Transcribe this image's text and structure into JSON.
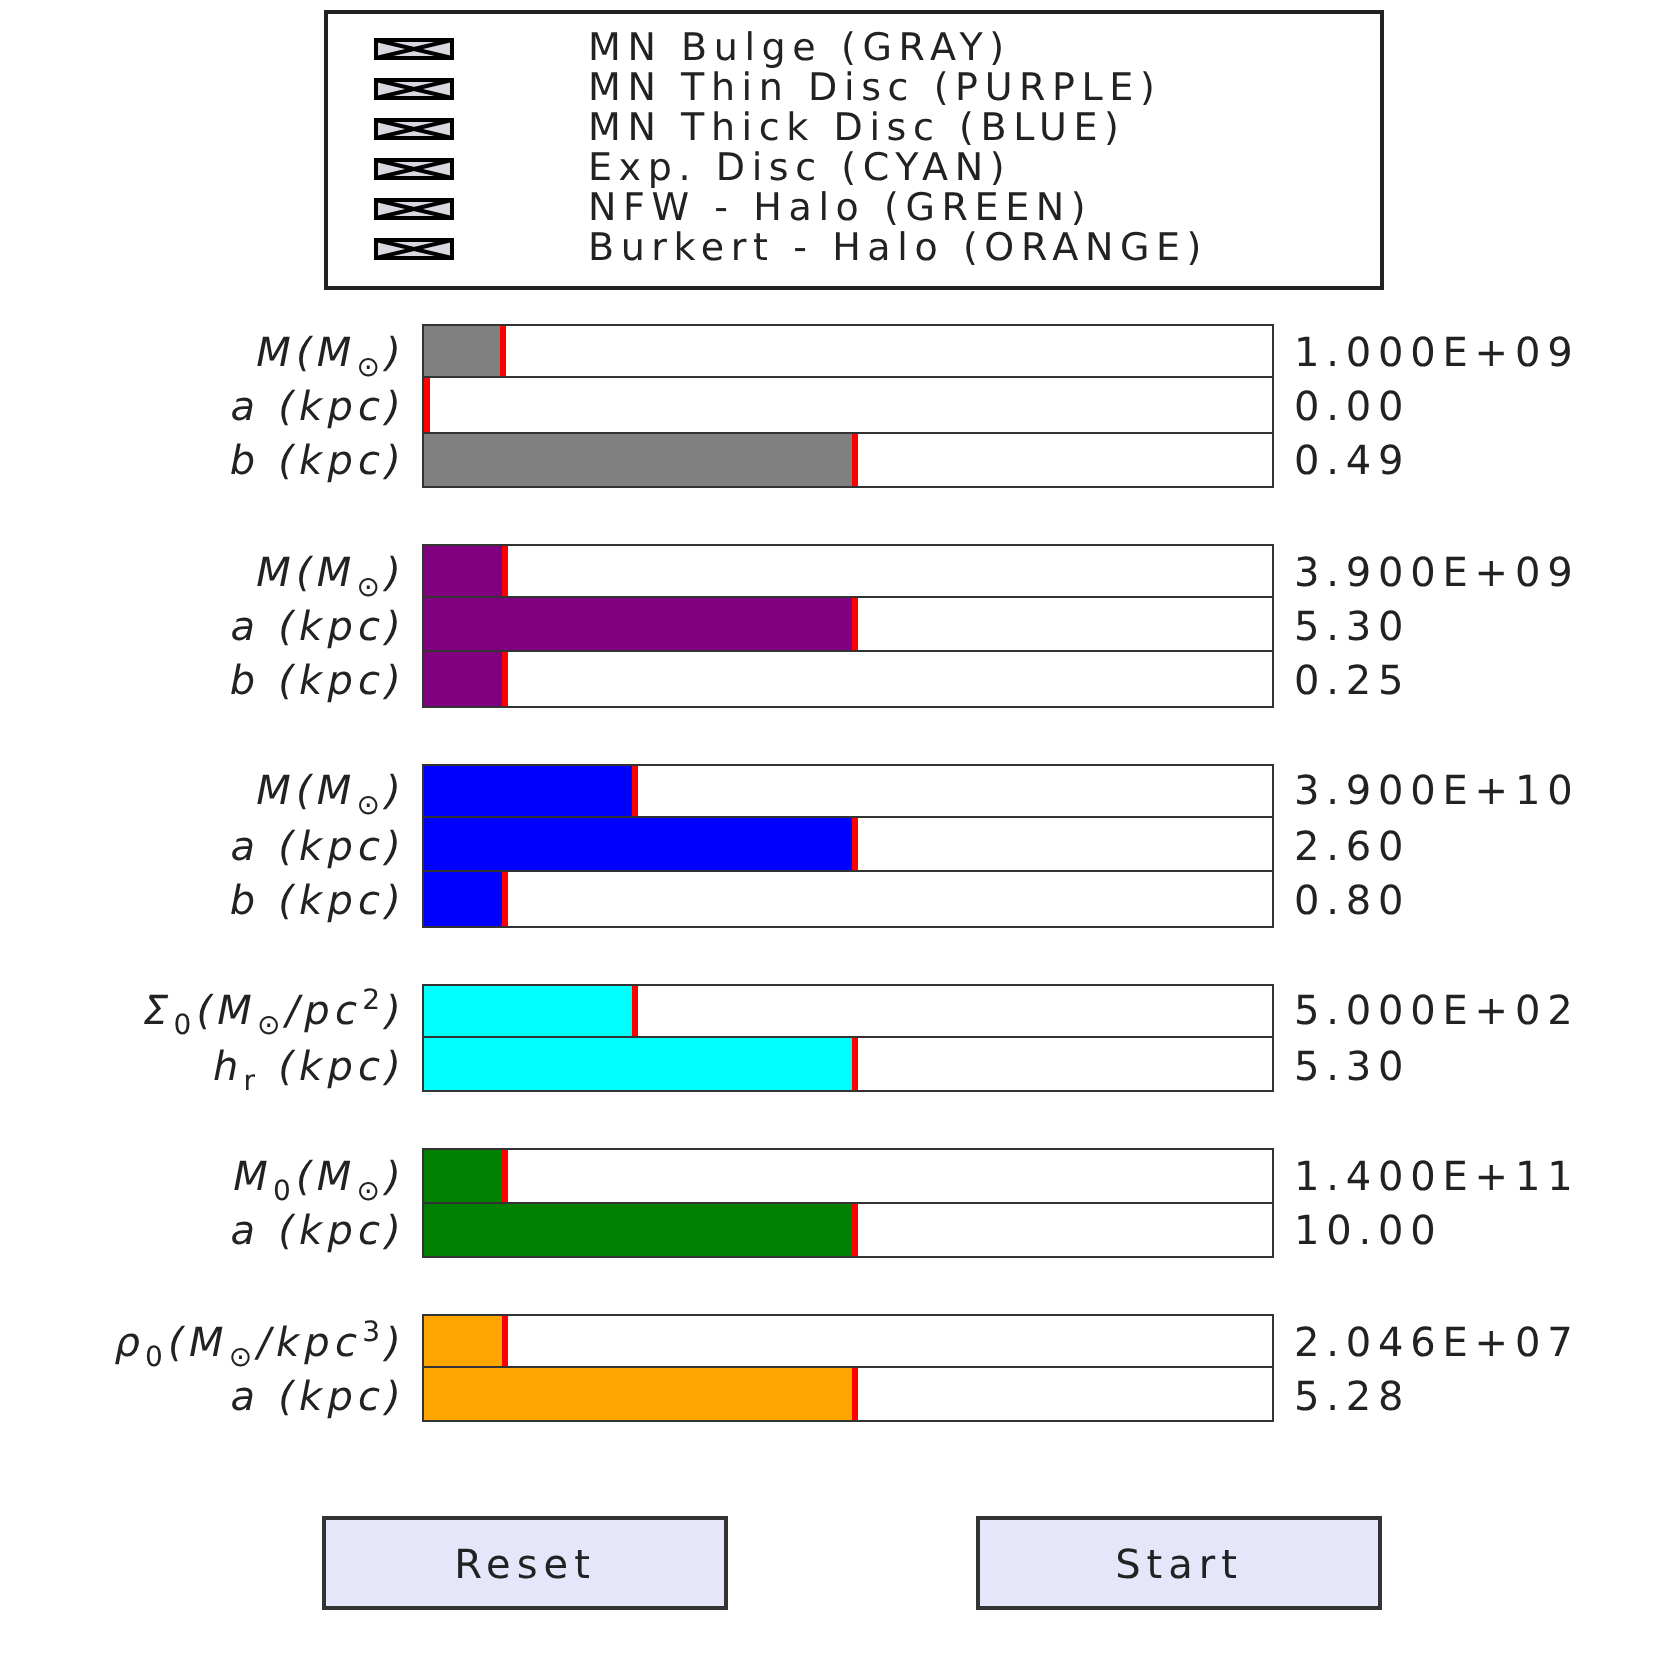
{
  "legend": {
    "items": [
      {
        "label": "MN Bulge (GRAY)",
        "checked": true
      },
      {
        "label": "MN Thin Disc (PURPLE)",
        "checked": true
      },
      {
        "label": "MN Thick Disc (BLUE)",
        "checked": true
      },
      {
        "label": "Exp. Disc (CYAN)",
        "checked": true
      },
      {
        "label": "NFW - Halo (GREEN)",
        "checked": true
      },
      {
        "label": "Burkert - Halo (ORANGE)",
        "checked": true
      }
    ]
  },
  "groups": [
    {
      "color": "#808080",
      "sliders": [
        {
          "label": "M(M$_{⊙}$)",
          "level": 0.09,
          "reading": "1.000E+09"
        },
        {
          "label": "a (kpc)",
          "level": 0,
          "reading": "0.00"
        },
        {
          "label": "b (kpc)",
          "level": 0.505,
          "reading": "0.49"
        }
      ]
    },
    {
      "color": "#800080",
      "sliders": [
        {
          "label": "M(M$_{⊙}$)",
          "level": 0.093,
          "reading": "3.900E+09"
        },
        {
          "label": "a (kpc)",
          "level": 0.505,
          "reading": "5.30"
        },
        {
          "label": "b (kpc)",
          "level": 0.093,
          "reading": "0.25"
        }
      ]
    },
    {
      "color": "#0000ff",
      "sliders": [
        {
          "label": "M(M$_{⊙}$)",
          "level": 0.245,
          "reading": "3.900E+10"
        },
        {
          "label": "a (kpc)",
          "level": 0.505,
          "reading": "2.60"
        },
        {
          "label": "b (kpc)",
          "level": 0.092,
          "reading": "0.80"
        }
      ]
    },
    {
      "color": "#00ffff",
      "sliders": [
        {
          "label": "Σ$_{0}$(M$_{⊙}$/pc$^{2}$)",
          "level": 0.245,
          "reading": "5.000E+02"
        },
        {
          "label": "h$_{r}$ (kpc)",
          "level": 0.505,
          "reading": "5.30"
        }
      ]
    },
    {
      "color": "#008000",
      "sliders": [
        {
          "label": "M$_{0}$(M$_{⊙}$)",
          "level": 0.092,
          "reading": "1.400E+11"
        },
        {
          "label": "a (kpc)",
          "level": 0.505,
          "reading": "10.00"
        }
      ]
    },
    {
      "color": "#ffa500",
      "sliders": [
        {
          "label": "ρ$_{0}$(M$_{⊙}$/kpc$^{3}$)",
          "level": 0.092,
          "reading": "2.046E+07"
        },
        {
          "label": "a (kpc)",
          "level": 0.505,
          "reading": "5.28"
        }
      ]
    }
  ],
  "buttons": [
    {
      "label": "Reset"
    },
    {
      "label": "Start"
    }
  ]
}
